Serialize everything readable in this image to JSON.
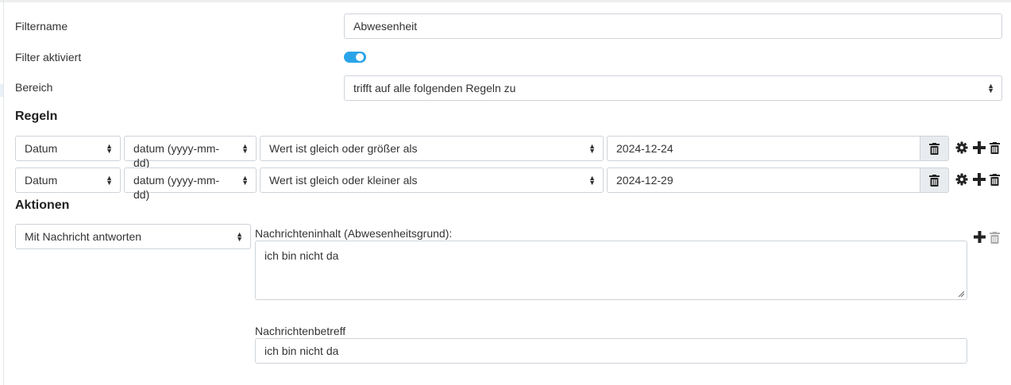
{
  "form": {
    "filtername_label": "Filtername",
    "filtername_value": "Abwesenheit",
    "aktiviert_label": "Filter aktiviert",
    "aktiviert_on": true,
    "bereich_label": "Bereich",
    "bereich_value": "trifft auf alle folgenden Regeln zu"
  },
  "regeln": {
    "heading": "Regeln",
    "rows": [
      {
        "field": "Datum",
        "type": "datum (yyyy-mm-dd)",
        "operator": "Wert ist gleich oder größer als",
        "value": "2024-12-24"
      },
      {
        "field": "Datum",
        "type": "datum (yyyy-mm-dd)",
        "operator": "Wert ist gleich oder kleiner als",
        "value": "2024-12-29"
      }
    ]
  },
  "aktionen": {
    "heading": "Aktionen",
    "action_value": "Mit Nachricht antworten",
    "inhalt_label": "Nachrichteninhalt (Abwesenheitsgrund):",
    "inhalt_value": "ich bin nicht da",
    "betreff_label": "Nachrichtenbetreff",
    "betreff_value": "ich bin nicht da"
  },
  "icons": {
    "trash": "trash-icon",
    "gear": "gear-icon",
    "plus": "plus-icon",
    "select_arrows": "sort-arrows-icon"
  },
  "colors": {
    "toggle": "#2aa4e8",
    "border": "#ced4da",
    "addon_bg": "#e9ecef"
  }
}
